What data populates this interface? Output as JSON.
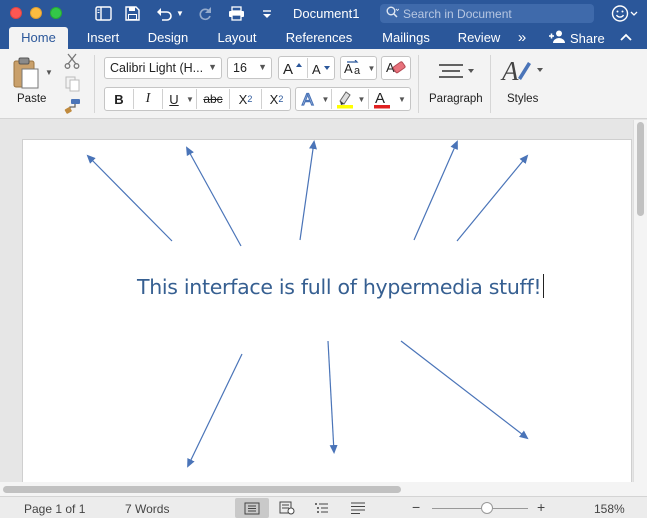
{
  "window": {
    "title": "Document1",
    "search_placeholder": "Search in Document"
  },
  "tabs": [
    {
      "label": "Home",
      "active": true
    },
    {
      "label": "Insert"
    },
    {
      "label": "Design"
    },
    {
      "label": "Layout"
    },
    {
      "label": "References"
    },
    {
      "label": "Mailings"
    },
    {
      "label": "Review"
    }
  ],
  "tabs_overflow": "»",
  "share_label": "Share",
  "ribbon": {
    "paste_label": "Paste",
    "font_name": "Calibri Light (H...",
    "font_size": "16",
    "bold": "B",
    "italic": "I",
    "underline": "U",
    "strikethrough": "abc",
    "subscript": "X",
    "subscript_mark": "2",
    "superscript": "X",
    "superscript_mark": "2",
    "paragraph_label": "Paragraph",
    "styles_label": "Styles",
    "highlight_color": "#ffff00",
    "font_color": "#e02020"
  },
  "document": {
    "text": "This interface is full of hypermedia stuff!",
    "text_color": "#365f91",
    "arrow_color": "#4a74b8"
  },
  "status": {
    "page": "Page 1 of 1",
    "words": "7 Words",
    "zoom": "158%",
    "zoom_level": 0.57
  },
  "icons": [
    "clipboard-icon",
    "scissors-icon",
    "copy-icon",
    "format-painter-icon",
    "save-icon",
    "undo-icon",
    "redo-icon",
    "print-icon",
    "search-icon",
    "smiley-icon"
  ]
}
